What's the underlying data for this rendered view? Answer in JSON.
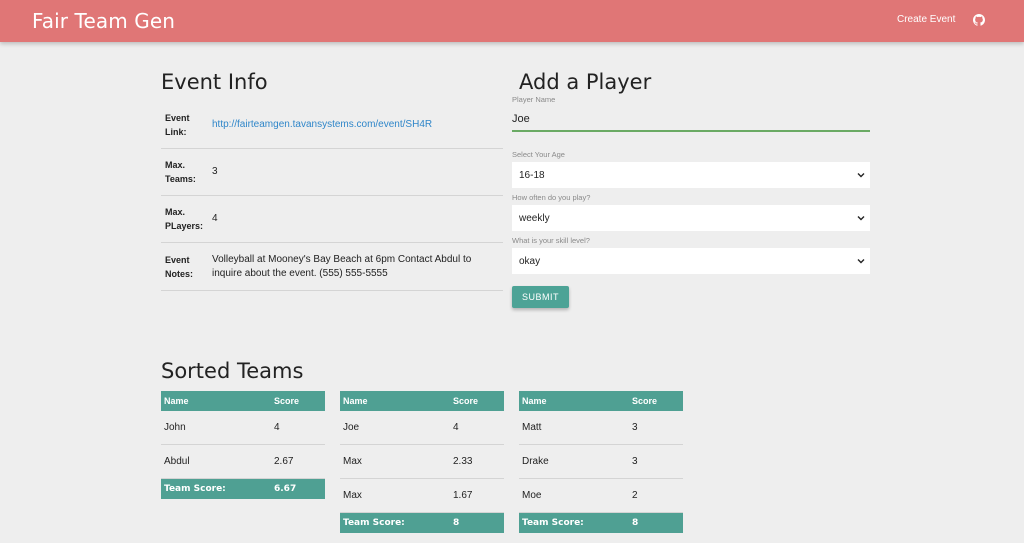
{
  "navbar": {
    "brand": "Fair Team Gen",
    "create_event": "Create Event",
    "github_icon": "github-icon"
  },
  "event_info": {
    "title": "Event Info",
    "rows": [
      {
        "key": "Event Link:",
        "value": "http://fairteamgen.tavansystems.com/event/SH4R",
        "is_link": true
      },
      {
        "key": "Max. Teams:",
        "value": "3"
      },
      {
        "key": "Max. PLayers:",
        "value": "4"
      },
      {
        "key": "Event Notes:",
        "value": "Volleyball at Mooney's Bay Beach at 6pm Contact Abdul to inquire about the event. (555) 555-5555"
      }
    ]
  },
  "add_player": {
    "title": "Add a Player",
    "name_label": "Player Name",
    "name_value": "Joe",
    "age_label": "Select Your Age",
    "age_value": "16-18",
    "freq_label": "How often do you play?",
    "freq_value": "weekly",
    "skill_label": "What is your skill level?",
    "skill_value": "okay",
    "submit_label": "SUBMIT"
  },
  "sorted_teams": {
    "title": "Sorted Teams",
    "col_name": "Name",
    "col_score": "Score",
    "team_score_label": "Team Score:",
    "teams": [
      {
        "players": [
          {
            "name": "John",
            "score": "4"
          },
          {
            "name": "Abdul",
            "score": "2.67"
          }
        ],
        "team_score": "6.67"
      },
      {
        "players": [
          {
            "name": "Joe",
            "score": "4"
          },
          {
            "name": "Max",
            "score": "2.33"
          },
          {
            "name": "Max",
            "score": "1.67"
          }
        ],
        "team_score": "8"
      },
      {
        "players": [
          {
            "name": "Matt",
            "score": "3"
          },
          {
            "name": "Drake",
            "score": "3"
          },
          {
            "name": "Moe",
            "score": "2"
          }
        ],
        "team_score": "8"
      }
    ]
  },
  "colors": {
    "navbar": "#e07676",
    "accent": "#4fa093",
    "link": "#2f86c9",
    "input_underline": "#6aaa64"
  }
}
